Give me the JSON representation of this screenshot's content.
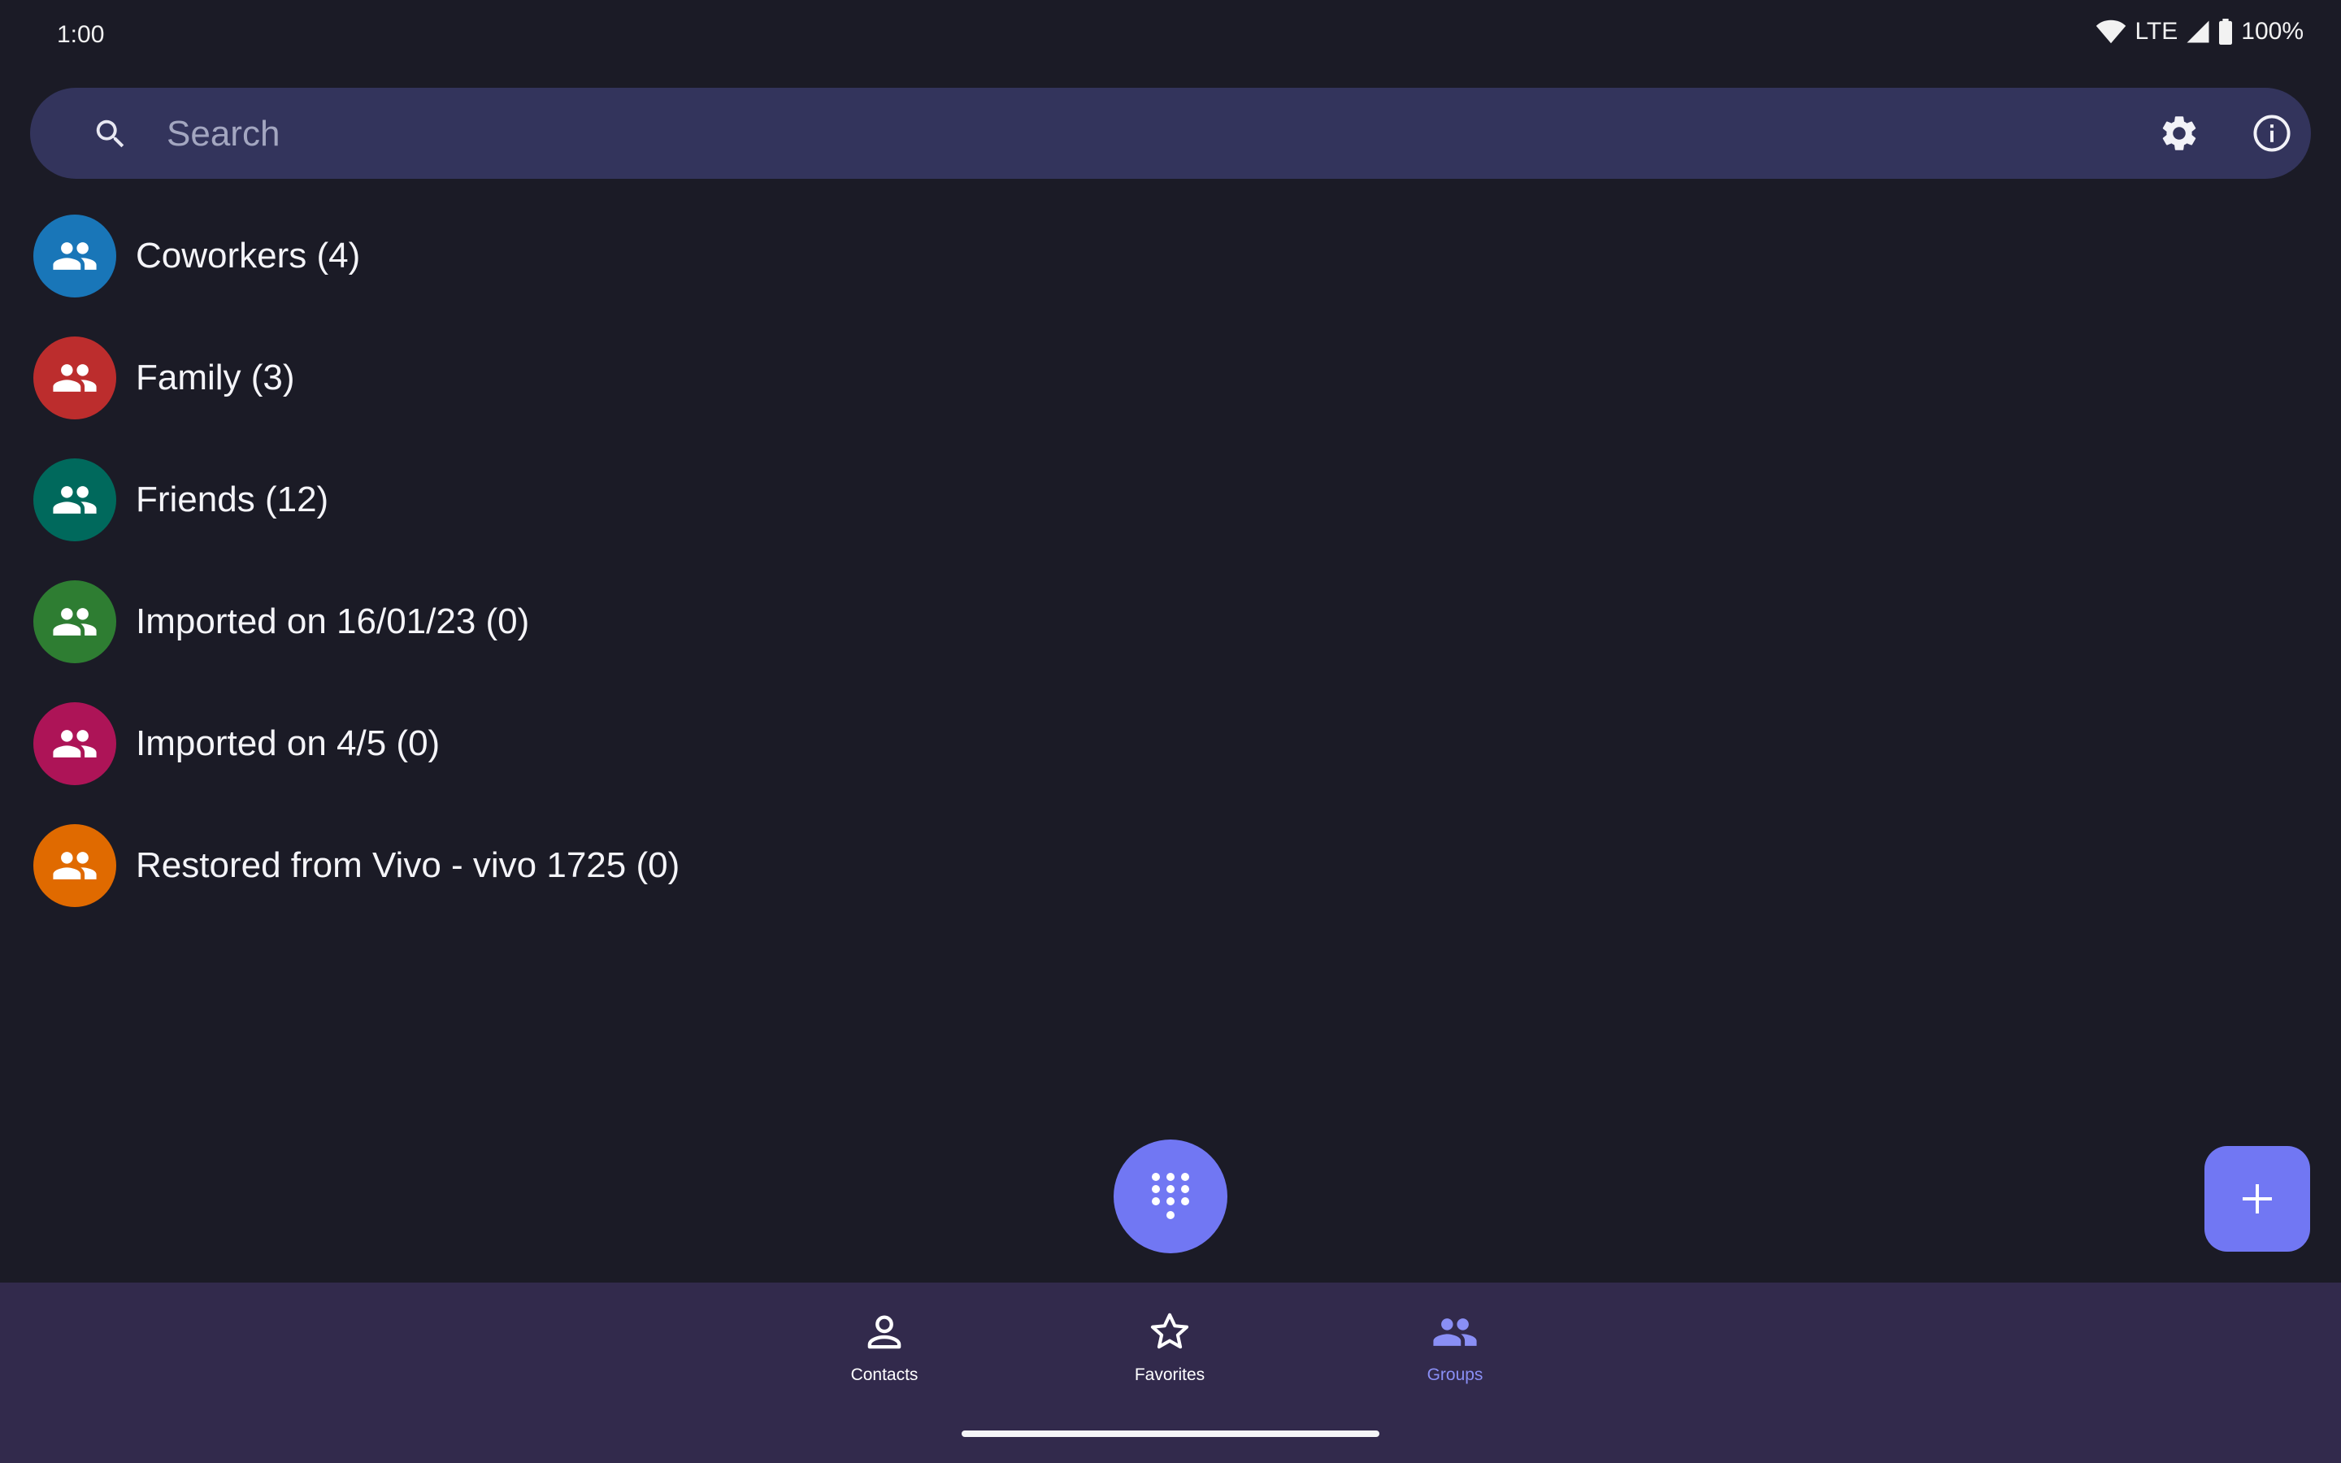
{
  "status_bar": {
    "time": "1:00",
    "network": "LTE",
    "battery": "100%"
  },
  "search": {
    "placeholder": "Search"
  },
  "groups": [
    {
      "name": "Coworkers (4)",
      "color": "#1976b8"
    },
    {
      "name": "Family (3)",
      "color": "#bc2d2d"
    },
    {
      "name": "Friends (12)",
      "color": "#00695c"
    },
    {
      "name": "Imported on 16/01/23 (0)",
      "color": "#2e7d32"
    },
    {
      "name": "Imported on 4/5 (0)",
      "color": "#ad1457"
    },
    {
      "name": "Restored from Vivo - vivo 1725 (0)",
      "color": "#e06a00"
    }
  ],
  "bottom_nav": {
    "items": [
      {
        "label": "Contacts",
        "icon": "person-outline-icon",
        "active": false
      },
      {
        "label": "Favorites",
        "icon": "star-outline-icon",
        "active": false
      },
      {
        "label": "Groups",
        "icon": "group-icon",
        "active": true
      }
    ]
  },
  "colors": {
    "background": "#1b1b26",
    "search_bar": "#33345c",
    "accent": "#7177f3",
    "nav_background": "#322a4c",
    "nav_active": "#8a8ff5"
  }
}
